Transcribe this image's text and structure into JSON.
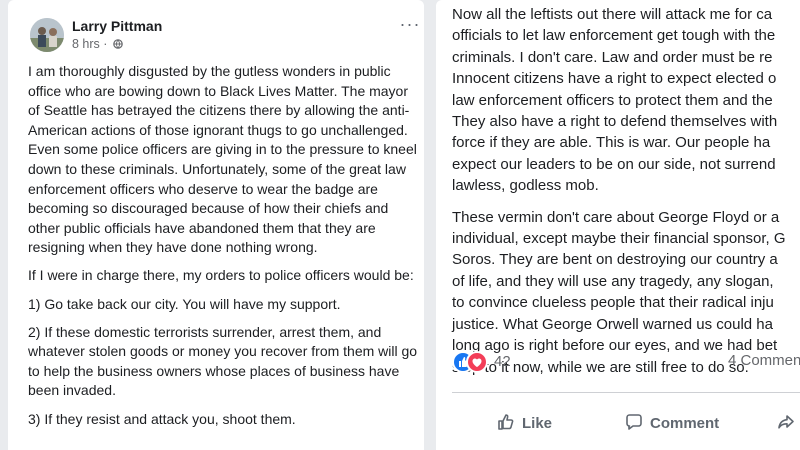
{
  "post": {
    "author": "Larry Pittman",
    "time": "8 hrs",
    "separator": "·",
    "paragraphs": [
      "I am thoroughly disgusted by the gutless wonders in public office who are bowing down to Black Lives Matter.  The mayor of Seattle has betrayed the citizens there by allowing the anti-American actions of those ignorant thugs to go unchallenged.  Even some police officers are giving in to the pressure to kneel down to these criminals.  Unfortunately, some of the great law enforcement officers who deserve to wear the badge are becoming so discouraged because of how their chiefs and other public officials have abandoned them that they are resigning when they have done nothing wrong.",
      "If I were in charge there, my orders to police officers would be:",
      "1)  Go take back our city.  You will have my support.",
      "2)  If these domestic terrorists surrender, arrest them, and whatever stolen goods or money you recover from them will go to help the business owners whose places of business have been invaded.",
      "3)  If they resist and attack you, shoot them."
    ]
  },
  "continuation": {
    "paragraph1_lines": [
      "Now all the leftists out there will attack me for ca",
      "officials to let law enforcement get tough with the",
      "criminals.  I don't care.  Law and order must be re",
      "Innocent citizens have a right to expect elected o",
      "law enforcement officers to protect them and the",
      "They also have a right to defend themselves with",
      "force if they are able.  This is war.  Our people ha",
      "expect our leaders to be on our side, not surrend",
      "lawless, godless mob."
    ],
    "paragraph2_lines": [
      "These vermin don't care about George Floyd or a",
      "individual, except maybe their financial sponsor, G",
      "Soros.  They are bent on destroying our country a",
      "of life, and they will use any tragedy, any slogan,",
      "to convince clueless people that their radical inju",
      "justice.  What George Orwell warned us could ha",
      "long ago is right before our eyes, and we had bet",
      "stop to it now, while we are still free to do so."
    ]
  },
  "reactions": {
    "count": "42",
    "comments": "4 Commen",
    "icons": [
      "like-icon",
      "love-icon"
    ],
    "like_color": "#1877f2",
    "love_color": "#f33e58"
  },
  "actions": {
    "like_label": "Like",
    "comment_label": "Comment"
  }
}
